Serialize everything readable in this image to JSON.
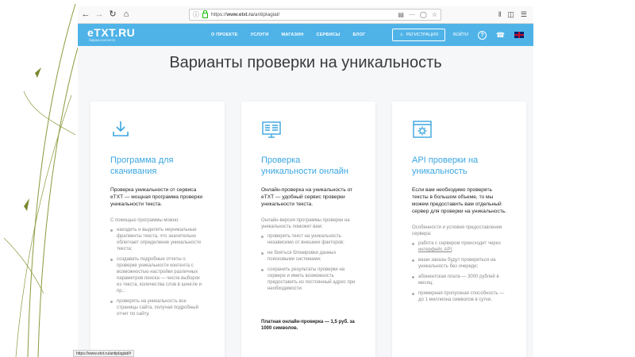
{
  "browser": {
    "url_domain": "www.etxt.ru",
    "url_path": "/antiplagiat/",
    "url_prefix": "https://",
    "status_url": "https://www.etxt.ru/antiplagiat/#"
  },
  "header": {
    "logo": "eTXT.RU",
    "logo_sub": "биржа контента",
    "menu": [
      "О ПРОЕКТЕ",
      "УСЛУГИ",
      "МАГАЗИН",
      "СЕРВИСЫ",
      "БЛОГ"
    ],
    "register": "РЕГИСТРАЦИЯ",
    "login": "ВОЙТИ",
    "accent_color": "#4fb3e8"
  },
  "page": {
    "title": "Варианты проверки на уникальность"
  },
  "cards": [
    {
      "icon": "download-icon",
      "title": "Программа для скачивания",
      "lead": "Проверка уникальности от сервиса eTXT — мощная программа проверки уникальности текста.",
      "intro": "С помощью программы можно:",
      "items": [
        "находить и выделять неуникальные фрагменты текста, что значительно облегчает определение уникальности текста;",
        "создавать подробные отчеты о проверке уникальности контента с возможностью настройки различных параметров поиска — числа выборок из текста, количества слов в шингле и пр.;",
        "проверять на уникальность все страницы сайта, получая подробный отчет по сайту."
      ]
    },
    {
      "icon": "monitor-text-icon",
      "title": "Проверка уникальности онлайн",
      "lead": "Онлайн-проверка на уникальность от eTXT — удобный сервис проверки уникальности текста.",
      "intro": "Онлайн-версия программы проверки на уникальность поможет вам:",
      "items": [
        "проверить текст на уникальность независимо от внешних факторов;",
        "не бояться блокировки данных поисковыми системами;",
        "сохранить результаты проверки на сервере и иметь возможность предоставить из постоянный адрес при необходимости."
      ],
      "price": "Платная онлайн-проверка — 1,5 руб. за 1000 символов."
    },
    {
      "icon": "api-gear-icon",
      "title": "API проверки на уникальность",
      "lead": "Если вам необходимо проверять тексты в большом объеме, то мы можем предоставить вам отдельный сервер для проверки на уникальность.",
      "intro": "Особенности и условия предоставления сервера:",
      "items_api": {
        "first_prefix": "работа с сервером происходит через ",
        "first_link": "интерфейс API",
        "first_suffix": ";",
        "rest": [
          "ваши заказы будут проверяться на уникальность без очереди;",
          "абонентская плата — 3000 рублей в месяц;",
          "примерная пропускная способность — до 1 миллиона символов в сутки."
        ]
      }
    }
  ]
}
